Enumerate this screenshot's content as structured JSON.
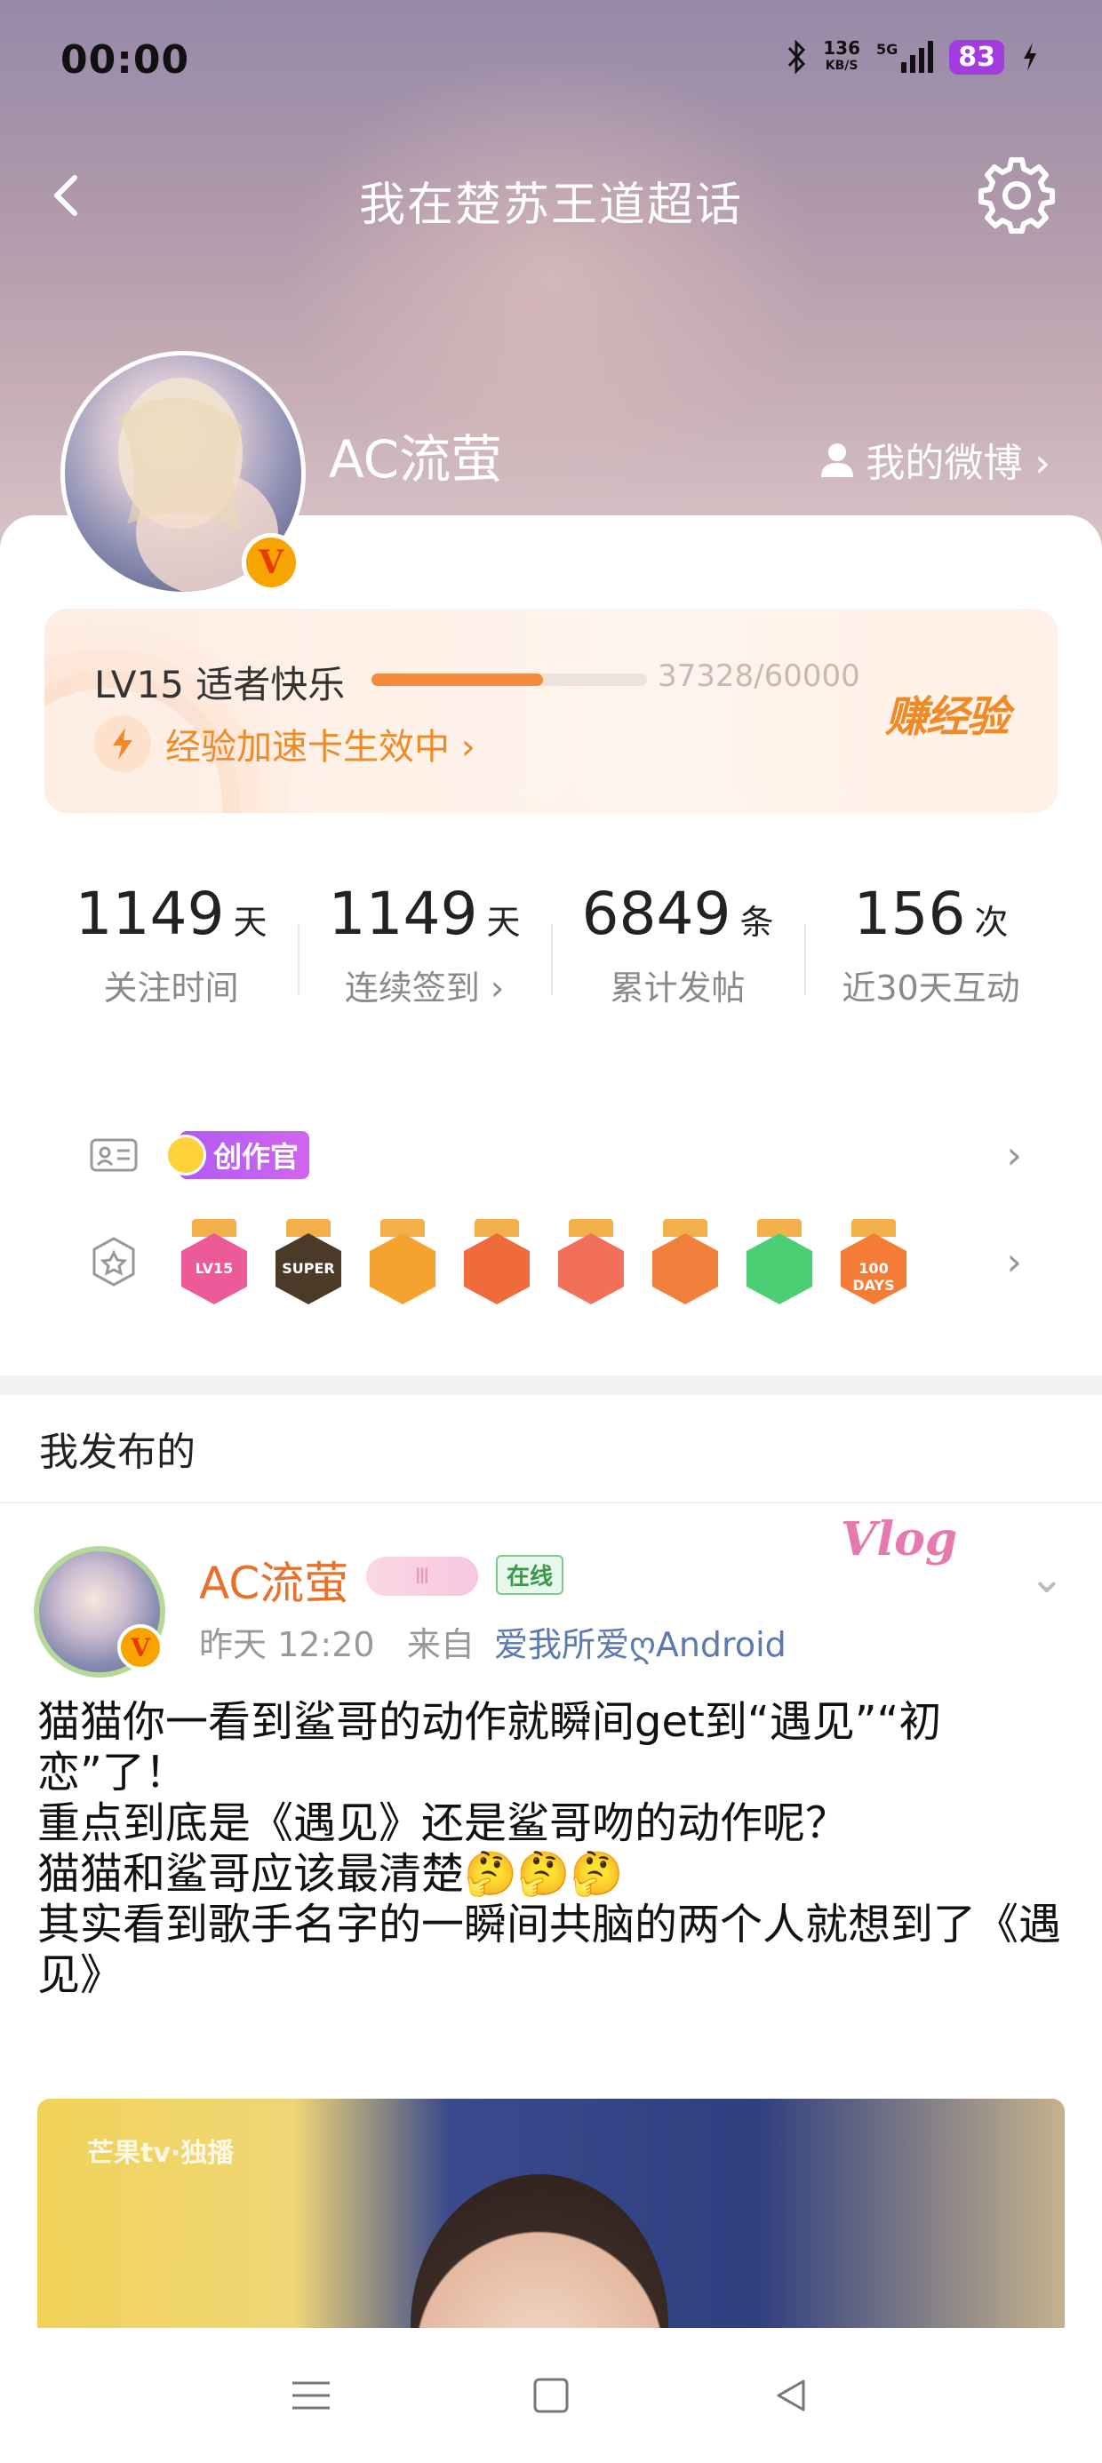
{
  "status_bar": {
    "time": "00:00",
    "speed_value": "136",
    "speed_unit": "KB/S",
    "network": "5G",
    "battery": "83"
  },
  "header": {
    "back_icon": "chevron-left-icon",
    "title": "我在楚苏王道超话",
    "settings_icon": "gear-icon"
  },
  "profile": {
    "username": "AC流萤",
    "verified_badge": "V",
    "my_weibo_label": "我的微博 ›"
  },
  "level": {
    "label": "LV15 适者快乐",
    "progress_text": "37328/60000",
    "progress": 0.622,
    "boost_label": "经验加速卡生效中 ›",
    "earn_label": "赚经验",
    "accent_color": "#f08a26"
  },
  "stats": [
    {
      "value": "1149",
      "unit": "天",
      "label": "关注时间"
    },
    {
      "value": "1149",
      "unit": "天",
      "label": "连续签到 ›"
    },
    {
      "value": "6849",
      "unit": "条",
      "label": "累计发帖"
    },
    {
      "value": "156",
      "unit": "次",
      "label": "近30天互动"
    }
  ],
  "badges": {
    "creator_label": "创作官",
    "medals": [
      {
        "name": "lv15-medal",
        "text": "LV15",
        "color": "#ec5a9a"
      },
      {
        "name": "super-medal",
        "text": "SUPER",
        "color": "#4b3a28"
      },
      {
        "name": "crown-medal",
        "text": "",
        "color": "#f5a230"
      },
      {
        "name": "fox-medal-1",
        "text": "",
        "color": "#f06b3b"
      },
      {
        "name": "cat-medal",
        "text": "",
        "color": "#f2705a"
      },
      {
        "name": "fox-medal-2",
        "text": "",
        "color": "#f1803c"
      },
      {
        "name": "hand-medal",
        "text": "",
        "color": "#4ccf74"
      },
      {
        "name": "days-medal",
        "text": "100 DAYS",
        "color": "#f47c36"
      }
    ]
  },
  "section": {
    "title": "我发布的"
  },
  "post": {
    "author": "AC流萤",
    "vip_level": "Ⅲ",
    "online_label": "在线",
    "vlog_label": "Vlog",
    "time": "昨天 12:20",
    "from_label": "来自",
    "source": "爱我所爱ღAndroid",
    "lines": [
      "猫猫你一看到鲨哥的动作就瞬间get到“遇见”“初恋”了！",
      "重点到底是《遇见》还是鲨哥吻的动作呢？",
      "猫猫和鲨哥应该最清楚🤔🤔🤔",
      "其实看到歌手名字的一瞬间共脑的两个人就想到了《遇见》"
    ],
    "image_watermark": "芒果tv·独播"
  }
}
